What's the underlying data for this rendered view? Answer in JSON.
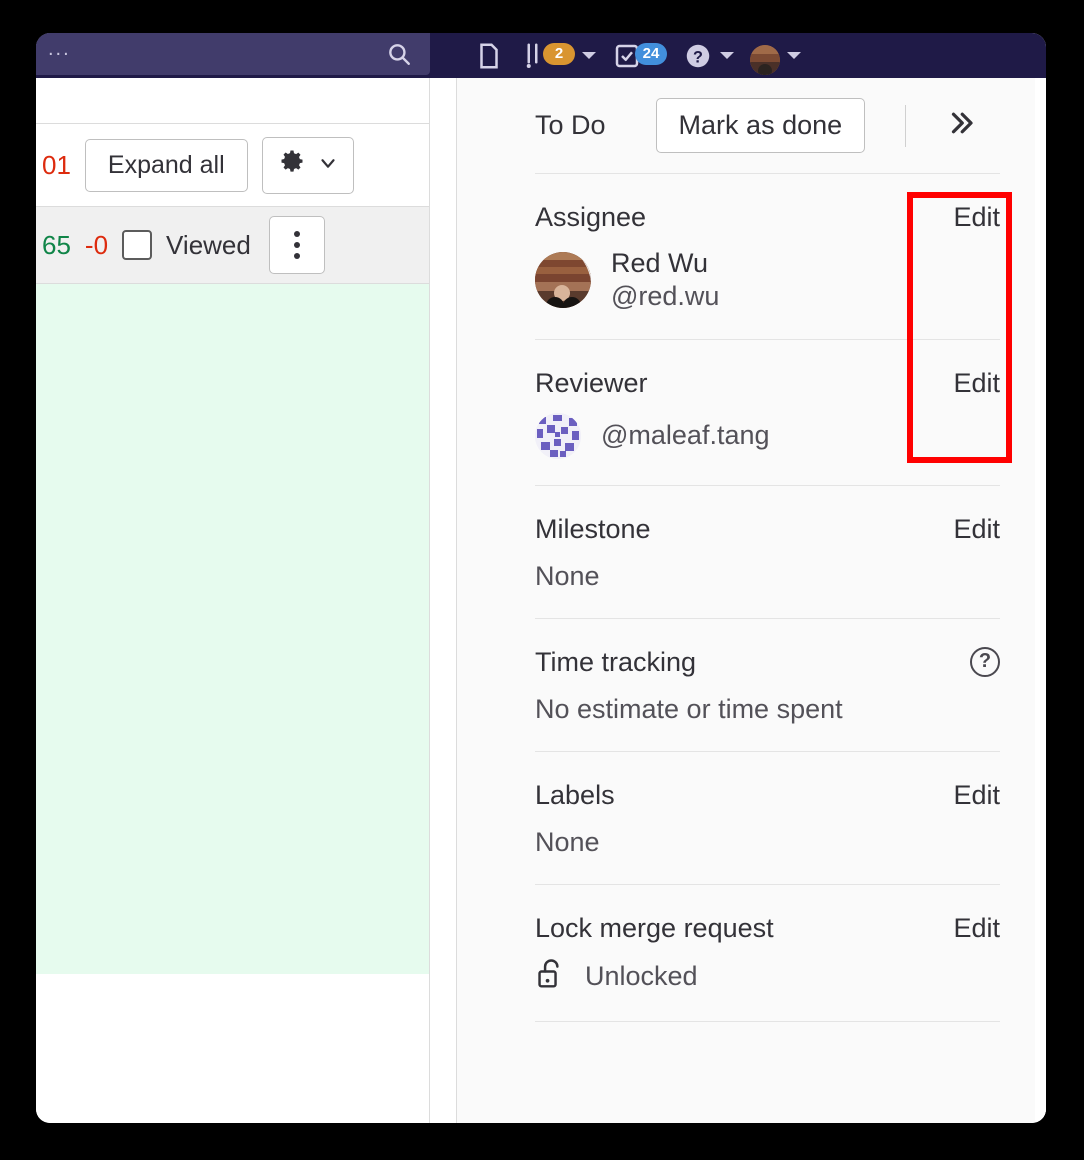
{
  "navbar": {
    "search_placeholder_ellipsis": "...",
    "search_icon": "search-icon",
    "items": [
      {
        "icon": "merge-request-icon",
        "name": "merge-requests",
        "badge": null,
        "badge_color": null,
        "caret": false
      },
      {
        "icon": "todo-list-icon",
        "name": "issues",
        "badge": "2",
        "badge_color": "#d99530",
        "caret": true
      },
      {
        "icon": "todo-done-icon",
        "name": "todos",
        "badge": "24",
        "badge_color": "#428fdc",
        "caret": false
      },
      {
        "icon": "help-question-icon",
        "name": "help",
        "badge": null,
        "badge_color": null,
        "caret": true
      },
      {
        "icon": "user-avatar-icon",
        "name": "user-menu",
        "badge": null,
        "badge_color": null,
        "caret": true
      }
    ]
  },
  "left_pane": {
    "diff_added_count": "65",
    "diff_removed_count": "-0",
    "changes_count": "01",
    "expand_all_label": "Expand all",
    "settings_icon": "gear-icon",
    "settings_caret_icon": "chevron-down-icon",
    "viewed_label": "Viewed",
    "viewed_checked": false,
    "more_actions_icon": "kebab-menu-icon"
  },
  "sidebar": {
    "todo": {
      "label": "To Do",
      "button_label": "Mark as done",
      "collapse_icon": "chevron-double-right-icon"
    },
    "sections": [
      {
        "key": "assignee",
        "title": "Assignee",
        "action": "Edit",
        "user_name": "Red Wu",
        "user_handle": "@red.wu",
        "avatar_type": "photo"
      },
      {
        "key": "reviewer",
        "title": "Reviewer",
        "action": "Edit",
        "user_handle": "@maleaf.tang",
        "avatar_type": "identicon"
      },
      {
        "key": "milestone",
        "title": "Milestone",
        "action": "Edit",
        "value": "None"
      },
      {
        "key": "time-tracking",
        "title": "Time tracking",
        "action_icon": "help-circle-icon",
        "value": "No estimate or time spent"
      },
      {
        "key": "labels",
        "title": "Labels",
        "action": "Edit",
        "value": "None"
      },
      {
        "key": "lock-merge-request",
        "title": "Lock merge request",
        "action": "Edit",
        "value": "Unlocked",
        "value_icon": "unlock-icon"
      }
    ]
  },
  "annotation": {
    "highlight_color": "#ff0000",
    "target": "edit-links-assignee-and-reviewer"
  },
  "colors": {
    "navbar_bg": "#1f1a47",
    "search_bg": "#413c6b",
    "sidebar_bg": "#fafafa",
    "diff_added_bg": "#e6fbee",
    "accent_red": "#dd2b0e",
    "accent_green": "#108548"
  }
}
